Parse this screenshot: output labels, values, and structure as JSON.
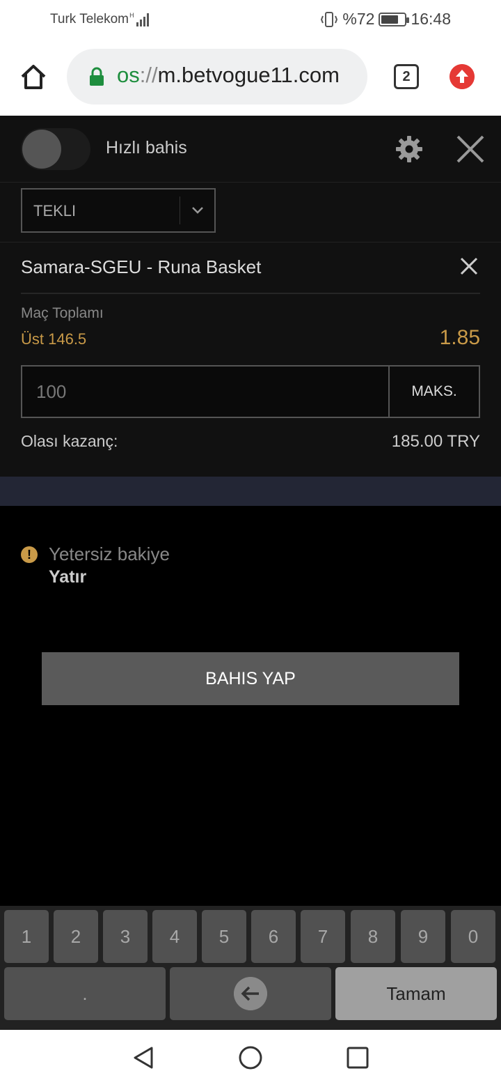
{
  "status_bar": {
    "carrier": "Turk Telekom",
    "battery": "%72",
    "battery_level": 0.72,
    "time": "16:48"
  },
  "browser": {
    "url_scheme": "os",
    "url_sep": "://",
    "url_host": "m.betvogue11.com",
    "tab_count": "2"
  },
  "betslip": {
    "quick_bet_label": "Hızlı bahis",
    "slip_type": "TEKLI",
    "match": "Samara-SGEU - Runa Basket",
    "market": "Maç Toplamı",
    "selection": "Üst 146.5",
    "odds": "1.85",
    "stake_placeholder": "100",
    "max_label": "MAKS.",
    "potential_win_label": "Olası kazanç:",
    "potential_win_value": "185.00 TRY"
  },
  "notice": {
    "warning_text": "Yetersiz bakiye",
    "deposit_link": "Yatır",
    "warning_icon_glyph": "!"
  },
  "actions": {
    "place_bet": "BAHIS YAP"
  },
  "keyboard": {
    "digits": [
      "1",
      "2",
      "3",
      "4",
      "5",
      "6",
      "7",
      "8",
      "9",
      "0"
    ],
    "dot": ".",
    "done": "Tamam"
  },
  "icons": {
    "home": "home-icon",
    "lock": "lock-icon",
    "settings": "gear-icon",
    "close": "close-icon",
    "chevron": "chevron-down-icon",
    "backspace": "backspace-icon",
    "update": "update-arrow-icon"
  },
  "colors": {
    "accent_gold": "#c99a48",
    "secure_green": "#1e8e3e",
    "update_red": "#e53935"
  }
}
